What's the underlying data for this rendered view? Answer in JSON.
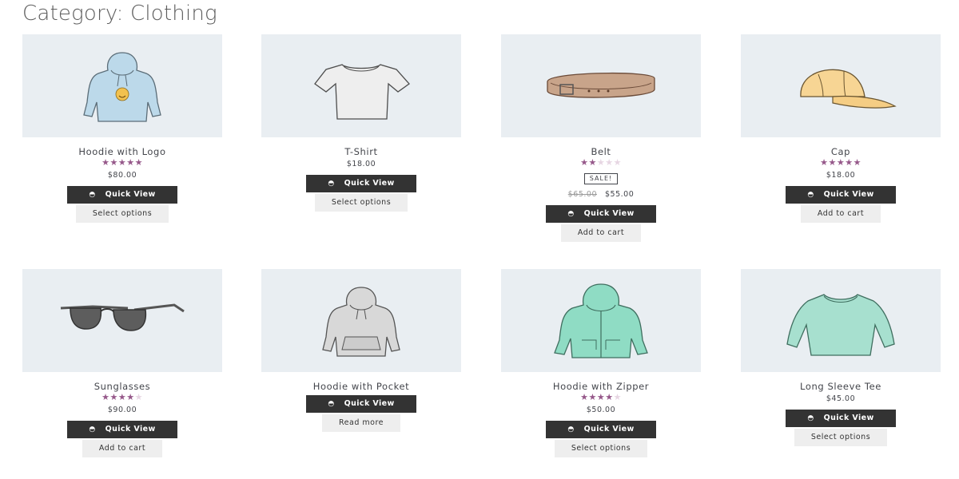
{
  "page": {
    "title": "Category: Clothing"
  },
  "quick_view_label": "Quick View",
  "colors": {
    "star": "#96588a",
    "thumb_bg": "#e9eef2",
    "quick_view_bg": "#333333"
  },
  "products": [
    {
      "name": "Hoodie with Logo",
      "rating": 5,
      "price": "$80.00",
      "action": "Select options",
      "icon": "hoodie-with-logo-image"
    },
    {
      "name": "T-Shirt",
      "rating": 0,
      "price": "$18.00",
      "action": "Select options",
      "icon": "t-shirt-image"
    },
    {
      "name": "Belt",
      "rating": 2,
      "sale_badge": "SALE!",
      "old_price": "$65.00",
      "price": "$55.00",
      "action": "Add to cart",
      "icon": "belt-image"
    },
    {
      "name": "Cap",
      "rating": 5,
      "price": "$18.00",
      "action": "Add to cart",
      "icon": "cap-image"
    },
    {
      "name": "Sunglasses",
      "rating": 4,
      "price": "$90.00",
      "action": "Add to cart",
      "icon": "sunglasses-image"
    },
    {
      "name": "Hoodie with Pocket",
      "rating": 0,
      "price": "",
      "action": "Read more",
      "icon": "hoodie-with-pocket-image"
    },
    {
      "name": "Hoodie with Zipper",
      "rating": 4,
      "price": "$50.00",
      "action": "Select options",
      "icon": "hoodie-with-zipper-image"
    },
    {
      "name": "Long Sleeve Tee",
      "rating": 0,
      "price": "$45.00",
      "action": "Select options",
      "icon": "long-sleeve-tee-image"
    }
  ]
}
